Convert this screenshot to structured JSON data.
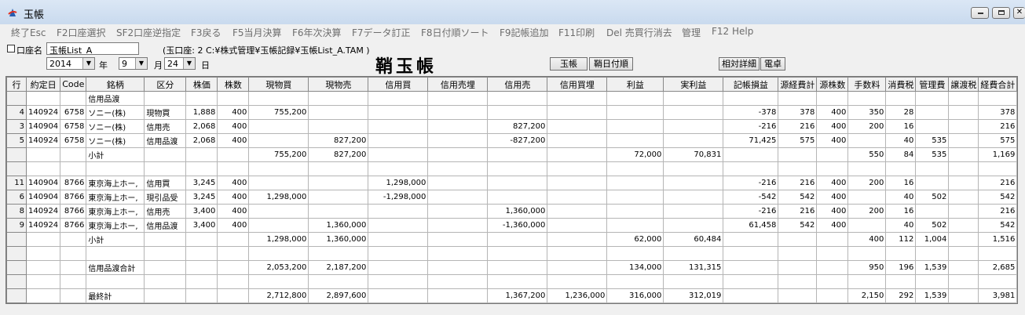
{
  "window": {
    "title": "玉帳",
    "min_icon": "minimize-icon",
    "max_icon": "maximize-icon",
    "close_icon": "close-icon"
  },
  "menu": [
    "終了Esc",
    "F2口座選択",
    "SF2口座逆指定",
    "F3戻る",
    "F5当月決算",
    "F6年次決算",
    "F7データ訂正",
    "F8日付順ソート",
    "F9記帳追加",
    "F11印刷",
    "Del 売買行消去",
    "管理",
    "F12 Help"
  ],
  "account": {
    "label": "口座名",
    "name_value": "玉帳List_A",
    "path_text": "(玉口座: 2 C:¥株式管理¥玉帳記録¥玉帳List_A.TAM )",
    "year": "2014",
    "year_label": "年",
    "month": "9",
    "month_label": "月",
    "day": "24",
    "day_label": "日"
  },
  "page_title": "鞘玉帳",
  "buttons": {
    "tamacho": "玉帳",
    "date_order": "鞘日付順",
    "relative_detail": "相対詳細",
    "calculator": "電卓"
  },
  "columns": [
    "行",
    "約定日",
    "Code",
    "銘柄",
    "区分",
    "株価",
    "株数",
    "現物買",
    "現物売",
    "信用買",
    "信用売埋",
    "信用売",
    "信用買埋",
    "利益",
    "実利益",
    "記帳損益",
    "源経費計",
    "源株数",
    "手数料",
    "消費税",
    "管理費",
    "譲渡税",
    "経費合計"
  ],
  "rows": [
    [
      "",
      "",
      "",
      "信用品渡",
      "",
      "",
      "",
      "",
      "",
      "",
      "",
      "",
      "",
      "",
      "",
      "",
      "",
      "",
      "",
      "",
      "",
      "",
      ""
    ],
    [
      "4",
      "140924",
      "6758",
      "ソニー(株)",
      "現物買",
      "1,888",
      "400",
      "755,200",
      "",
      "",
      "",
      "",
      "",
      "",
      "",
      "-378",
      "378",
      "400",
      "350",
      "28",
      "",
      "",
      "378"
    ],
    [
      "3",
      "140904",
      "6758",
      "ソニー(株)",
      "信用売",
      "2,068",
      "400",
      "",
      "",
      "",
      "",
      "827,200",
      "",
      "",
      "",
      "-216",
      "216",
      "400",
      "200",
      "16",
      "",
      "",
      "216"
    ],
    [
      "5",
      "140924",
      "6758",
      "ソニー(株)",
      "信用品渡",
      "2,068",
      "400",
      "",
      "827,200",
      "",
      "",
      "-827,200",
      "",
      "",
      "",
      "71,425",
      "575",
      "400",
      "",
      "40",
      "535",
      "",
      "575"
    ],
    [
      "",
      "",
      "",
      "小計",
      "",
      "",
      "",
      "755,200",
      "827,200",
      "",
      "",
      "",
      "",
      "72,000",
      "70,831",
      "",
      "",
      "",
      "550",
      "84",
      "535",
      "",
      "1,169"
    ],
    [
      "",
      "",
      "",
      "",
      "",
      "",
      "",
      "",
      "",
      "",
      "",
      "",
      "",
      "",
      "",
      "",
      "",
      "",
      "",
      "",
      "",
      "",
      ""
    ],
    [
      "11",
      "140904",
      "8766",
      "東京海上ホー,",
      "信用買",
      "3,245",
      "400",
      "",
      "",
      "1,298,000",
      "",
      "",
      "",
      "",
      "",
      "-216",
      "216",
      "400",
      "200",
      "16",
      "",
      "",
      "216"
    ],
    [
      "6",
      "140904",
      "8766",
      "東京海上ホー,",
      "現引品受",
      "3,245",
      "400",
      "1,298,000",
      "",
      "-1,298,000",
      "",
      "",
      "",
      "",
      "",
      "-542",
      "542",
      "400",
      "",
      "40",
      "502",
      "",
      "542"
    ],
    [
      "8",
      "140924",
      "8766",
      "東京海上ホー,",
      "信用売",
      "3,400",
      "400",
      "",
      "",
      "",
      "",
      "1,360,000",
      "",
      "",
      "",
      "-216",
      "216",
      "400",
      "200",
      "16",
      "",
      "",
      "216"
    ],
    [
      "9",
      "140924",
      "8766",
      "東京海上ホー,",
      "信用品渡",
      "3,400",
      "400",
      "",
      "1,360,000",
      "",
      "",
      "-1,360,000",
      "",
      "",
      "",
      "61,458",
      "542",
      "400",
      "",
      "40",
      "502",
      "",
      "542"
    ],
    [
      "",
      "",
      "",
      "小計",
      "",
      "",
      "",
      "1,298,000",
      "1,360,000",
      "",
      "",
      "",
      "",
      "62,000",
      "60,484",
      "",
      "",
      "",
      "400",
      "112",
      "1,004",
      "",
      "1,516"
    ],
    [
      "",
      "",
      "",
      "",
      "",
      "",
      "",
      "",
      "",
      "",
      "",
      "",
      "",
      "",
      "",
      "",
      "",
      "",
      "",
      "",
      "",
      "",
      ""
    ],
    [
      "",
      "",
      "",
      "信用品渡合計",
      "",
      "",
      "",
      "2,053,200",
      "2,187,200",
      "",
      "",
      "",
      "",
      "134,000",
      "131,315",
      "",
      "",
      "",
      "950",
      "196",
      "1,539",
      "",
      "2,685"
    ],
    [
      "",
      "",
      "",
      "",
      "",
      "",
      "",
      "",
      "",
      "",
      "",
      "",
      "",
      "",
      "",
      "",
      "",
      "",
      "",
      "",
      "",
      "",
      ""
    ],
    [
      "",
      "",
      "",
      "最終計",
      "",
      "",
      "",
      "2,712,800",
      "2,897,600",
      "",
      "",
      "1,367,200",
      "1,236,000",
      "316,000",
      "312,019",
      "",
      "",
      "",
      "2,150",
      "292",
      "1,539",
      "",
      "3,981"
    ]
  ]
}
